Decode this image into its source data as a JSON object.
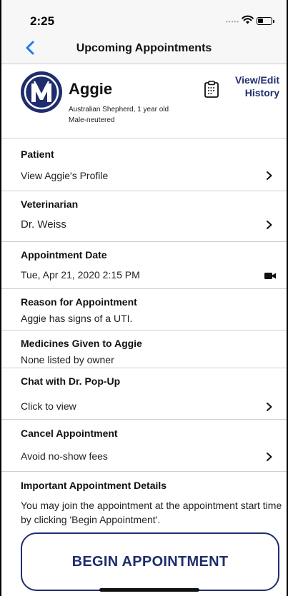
{
  "status_bar": {
    "time": "2:25"
  },
  "nav": {
    "title": "Upcoming Appointments"
  },
  "pet": {
    "name": "Aggie",
    "breed_age": "Australian Shepherd, 1 year old",
    "sex": "Male-neutered",
    "history_line1": "View/Edit",
    "history_line2": "History"
  },
  "sections": {
    "patient": {
      "title": "Patient",
      "value": "View Aggie's Profile"
    },
    "veterinarian": {
      "title": "Veterinarian",
      "value": "Dr. Weiss"
    },
    "appointment_date": {
      "title": "Appointment Date",
      "value": "Tue, Apr 21, 2020 2:15 PM"
    },
    "reason": {
      "title": "Reason for Appointment",
      "value": "Aggie has signs of a UTI."
    },
    "medicines": {
      "title": "Medicines Given to Aggie",
      "value": "None listed by owner"
    },
    "chat": {
      "title": "Chat with Dr. Pop-Up",
      "value": "Click to view"
    },
    "cancel": {
      "title": "Cancel Appointment",
      "value": "Avoid no-show fees"
    },
    "details": {
      "title": "Important Appointment Details",
      "value": "You may join the appointment at the appointment start time by clicking 'Begin Appointment'."
    }
  },
  "begin_button": {
    "label": "BEGIN APPOINTMENT"
  },
  "colors": {
    "brand_navy": "#1f2d6e",
    "ios_blue": "#1a7cf5"
  },
  "icons": [
    "back-chevron-icon",
    "clipboard-icon",
    "chevron-right-icon",
    "video-camera-icon",
    "wifi-icon",
    "battery-icon"
  ]
}
